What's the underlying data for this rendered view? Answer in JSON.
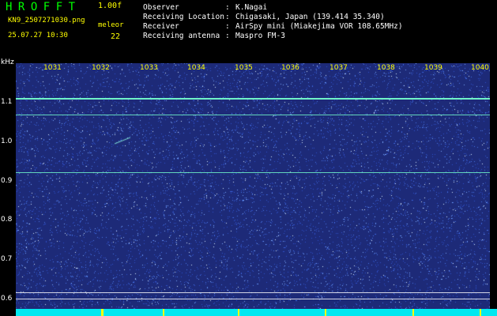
{
  "header": {
    "app_title": "HROFFT",
    "version": "1.00f",
    "filename": "KN9_2507271030.png",
    "timestamp": "25.07.27 10:30",
    "station_label": "meleor",
    "count": "22",
    "info": [
      {
        "label": "Observer",
        "value": "K.Nagai"
      },
      {
        "label": "Receiving Location",
        "value": "Chigasaki, Japan (139.414 35.340)"
      },
      {
        "label": "Receiver",
        "value": "AirSpy mini (Miakejima VOR 108.65MHz)"
      },
      {
        "label": "Receiving antenna",
        "value": "Maspro FM-3"
      }
    ]
  },
  "plot": {
    "unit_label": "kHz",
    "y_ticks": [
      "1.1",
      "1.0",
      "0.9",
      "0.8",
      "0.7",
      "0.6"
    ],
    "x_ticks": [
      "1031",
      "1032",
      "1033",
      "1034",
      "1035",
      "1036",
      "1037",
      "1038",
      "1039",
      "1040"
    ],
    "background_color": "#1d2a78",
    "signal_color": "#6ff2c8",
    "baseline_color": "#00e8f0"
  }
}
